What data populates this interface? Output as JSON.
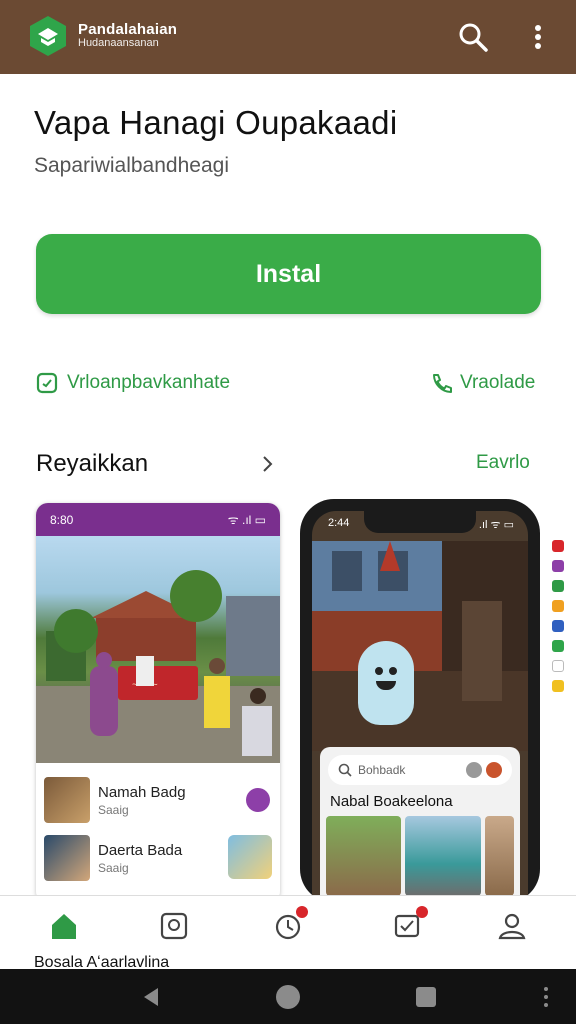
{
  "topbar": {
    "brand_name": "Pandalahaian",
    "brand_sub": "Hudanaansanan",
    "color": "#6b4a33",
    "icons": [
      "logo-hexagon-icon",
      "search-icon",
      "more-vertical-icon"
    ]
  },
  "app": {
    "title": "Vapa Hanagi Oupakaadi",
    "subtitle": "Sapariwialbandheagi"
  },
  "install_label": "Instal",
  "links": {
    "left_label": "Vrloanpbavkanhate",
    "right_label": "Vraolade"
  },
  "section": {
    "title": "Reyaikkan",
    "more_label": "Eavrlo"
  },
  "shot1": {
    "status_time": "8:80",
    "status_icons": "ᯤ .ıl ▭",
    "list": [
      {
        "title": "Namah Badg",
        "sub": "Saaig"
      },
      {
        "title": "Daerta Bada",
        "sub": "Saaig"
      }
    ]
  },
  "shot2": {
    "status_time": "2:44",
    "status_icons": ".ıl ᯤ ▭",
    "search_placeholder": "Bohbadk",
    "panel_title": "Nabal Boakeelona"
  },
  "bottom_nav": {
    "label": "Bosala Aʻaarlavlina",
    "items": [
      "home-icon",
      "discover-icon",
      "activity-icon",
      "tasks-icon",
      "profile-icon"
    ]
  },
  "colors": {
    "accent": "#3aac48",
    "link": "#2f9a46",
    "purple": "#7a2f8e",
    "badge": "#d8262b"
  }
}
